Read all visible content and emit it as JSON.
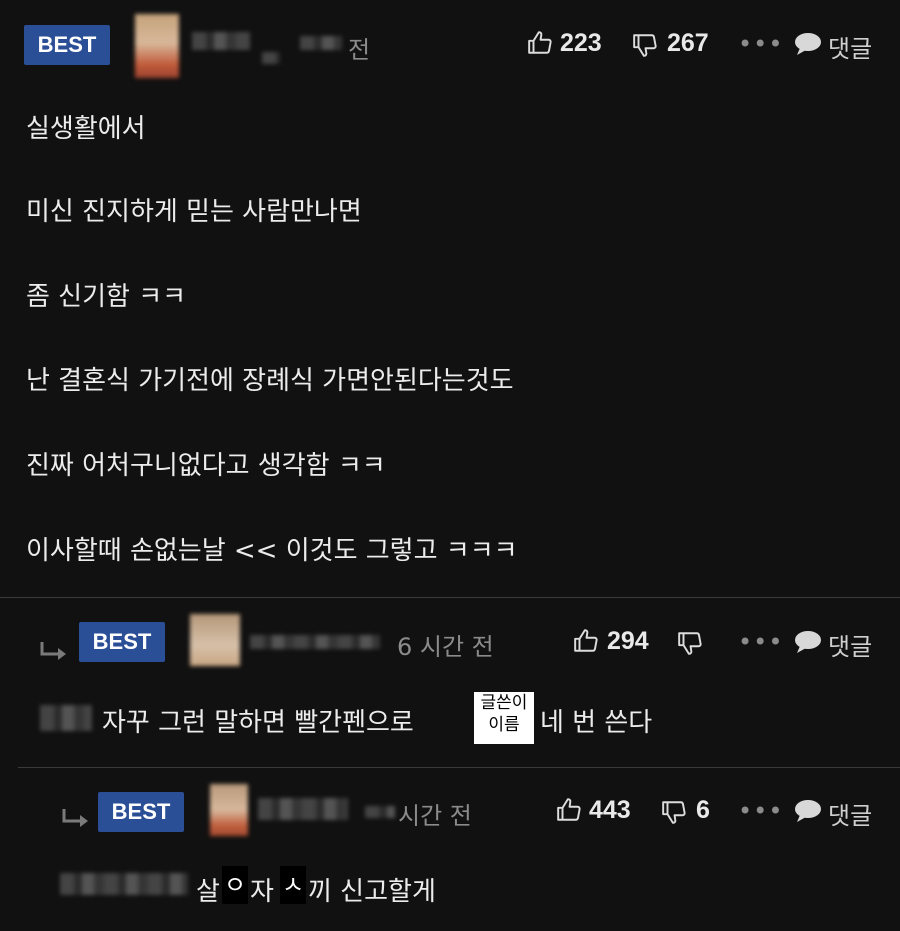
{
  "comments": [
    {
      "badge": "BEST",
      "time_fragment": "전",
      "likes": "223",
      "dislikes": "267",
      "more": "•••",
      "reply_label": "댓글",
      "lines": [
        "실생활에서",
        "미신 진지하게 믿는 사람만나면",
        "좀 신기함 ㅋㅋ",
        "난 결혼식 가기전에 장례식 가면안된다는것도",
        "진짜 어처구니없다고 생각함 ㅋㅋ",
        "이사할때 손없는날 << 이것도 그렇고 ㅋㅋㅋ"
      ]
    },
    {
      "badge": "BEST",
      "time": "6 시간 전",
      "likes": "294",
      "more": "•••",
      "reply_label": "댓글",
      "text_before": "자꾸 그런 말하면 빨간펜으로",
      "stamp_line1": "글쓴이",
      "stamp_line2": "이름",
      "text_after": "네 번 쓴다"
    },
    {
      "badge": "BEST",
      "time": "시간 전",
      "likes": "443",
      "dislikes": "6",
      "more": "•••",
      "reply_label": "댓글",
      "text_1": "살",
      "mask_1": "ㅇ",
      "text_2": "자",
      "mask_2": "ㅅ",
      "text_3": "끼 신고할게"
    }
  ],
  "colors": {
    "background": "#111111",
    "badge": "#2a4f96",
    "meta": "#8b8b8b",
    "text": "#ececec"
  },
  "icons": [
    "thumbs-up-icon",
    "thumbs-down-icon",
    "more-icon",
    "speech-bubble-icon",
    "reply-arrow-icon"
  ]
}
